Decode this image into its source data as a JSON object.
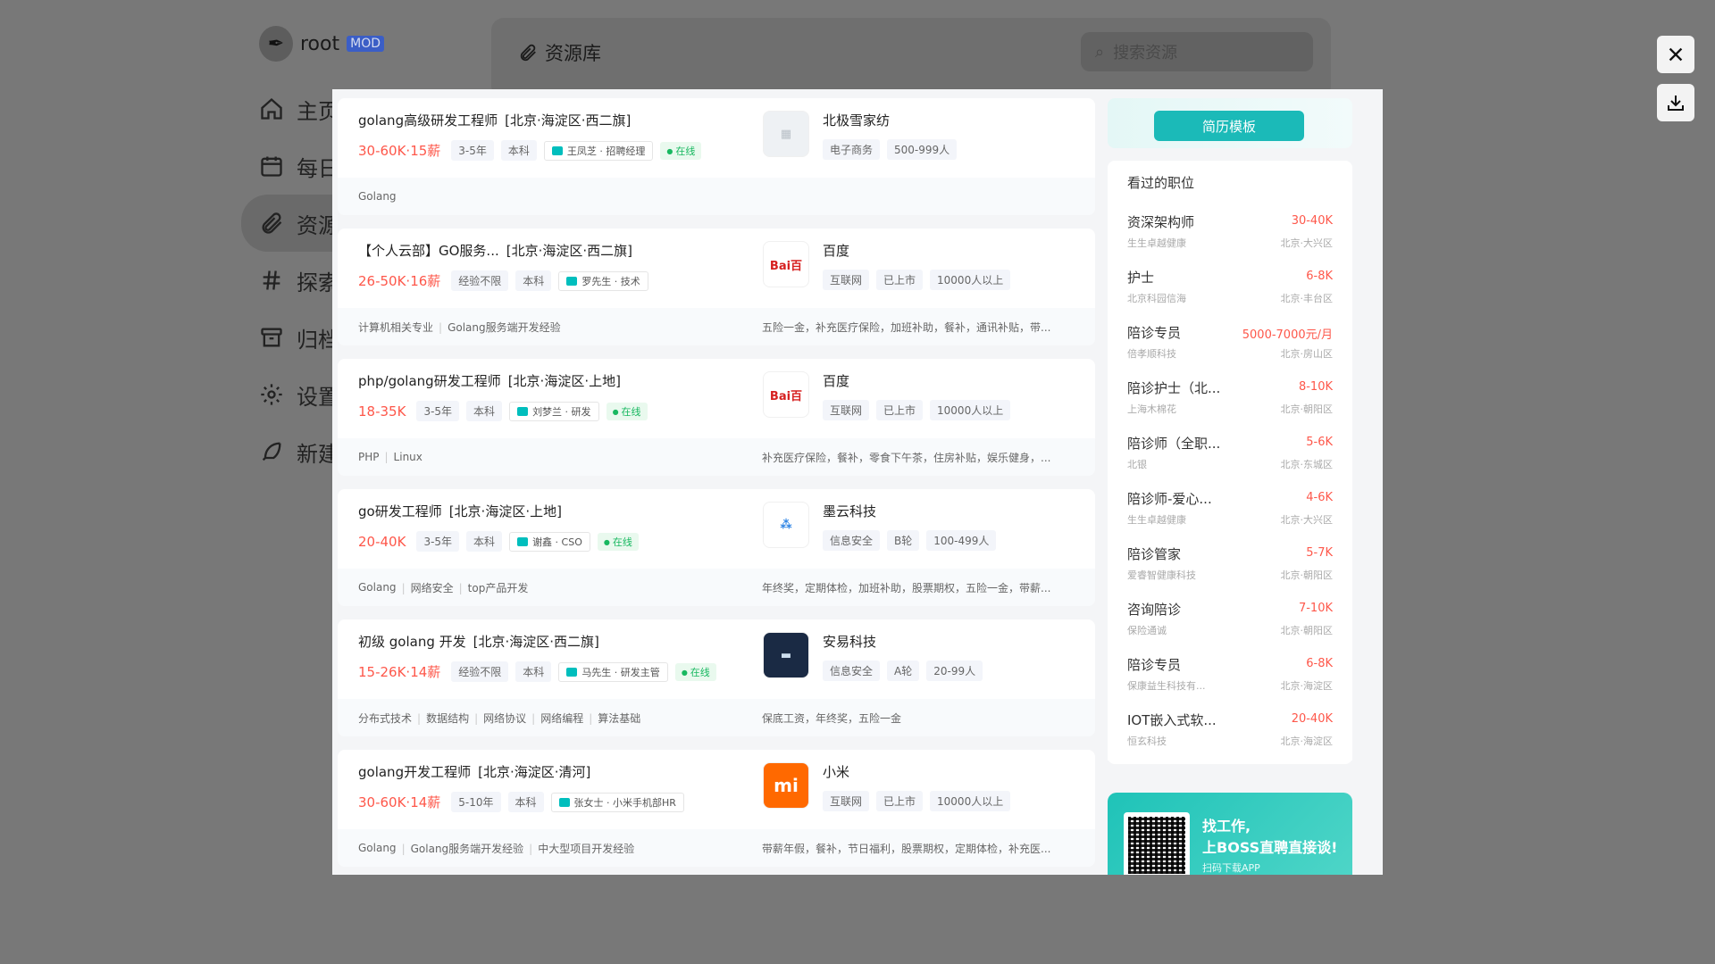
{
  "background": {
    "user": {
      "name": "root",
      "badge": "MOD"
    },
    "nav": [
      {
        "label": "主页",
        "icon": "home-icon"
      },
      {
        "label": "每日",
        "icon": "calendar-icon"
      },
      {
        "label": "资源",
        "icon": "paperclip-icon",
        "active": true
      },
      {
        "label": "探索",
        "icon": "hash-icon"
      },
      {
        "label": "归档",
        "icon": "archive-icon"
      },
      {
        "label": "设置",
        "icon": "settings-icon"
      },
      {
        "label": "新建",
        "icon": "feather-icon"
      }
    ],
    "main": {
      "title": "资源库",
      "search_placeholder": "搜索资源"
    }
  },
  "viewer_controls": {
    "close_icon": "close-icon",
    "download_icon": "download-icon"
  },
  "jobs": [
    {
      "title": "golang高级研发工程师",
      "area": "[北京·海淀区·西二旗]",
      "salary": "30-60K·15薪",
      "experience": "3-5年",
      "degree": "本科",
      "recruiter": "王凤芝 · 招聘经理",
      "online": "在线",
      "skills": [
        "Golang"
      ],
      "welfare": "",
      "company": "北极雪家纺",
      "company_tags": [
        "电子商务",
        "500-999人"
      ]
    },
    {
      "title": "【个人云部】GO服务...",
      "area": "[北京·海淀区·西二旗]",
      "salary": "26-50K·16薪",
      "experience": "经验不限",
      "degree": "本科",
      "recruiter": "罗先生 · 技术",
      "online": "",
      "skills": [
        "计算机相关专业",
        "Golang服务端开发经验"
      ],
      "welfare": "五险一金，补充医疗保险，加班补助，餐补，通讯补贴，带...",
      "company": "百度",
      "company_tags": [
        "互联网",
        "已上市",
        "10000人以上"
      ]
    },
    {
      "title": "php/golang研发工程师",
      "area": "[北京·海淀区·上地]",
      "salary": "18-35K",
      "experience": "3-5年",
      "degree": "本科",
      "recruiter": "刘梦兰 · 研发",
      "online": "在线",
      "skills": [
        "PHP",
        "Linux"
      ],
      "welfare": "补充医疗保险，餐补，零食下午茶，住房补贴，娱乐健身，...",
      "company": "百度",
      "company_tags": [
        "互联网",
        "已上市",
        "10000人以上"
      ]
    },
    {
      "title": "go研发工程师",
      "area": "[北京·海淀区·上地]",
      "salary": "20-40K",
      "experience": "3-5年",
      "degree": "本科",
      "recruiter": "谢鑫 · CSO",
      "online": "在线",
      "skills": [
        "Golang",
        "网络安全",
        "top产品开发"
      ],
      "welfare": "年终奖，定期体检，加班补助，股票期权，五险一金，带薪...",
      "company": "墨云科技",
      "company_tags": [
        "信息安全",
        "B轮",
        "100-499人"
      ]
    },
    {
      "title": "初级 golang 开发",
      "area": "[北京·海淀区·西二旗]",
      "salary": "15-26K·14薪",
      "experience": "经验不限",
      "degree": "本科",
      "recruiter": "马先生 · 研发主管",
      "online": "在线",
      "skills": [
        "分布式技术",
        "数据结构",
        "网络协议",
        "网络编程",
        "算法基础"
      ],
      "welfare": "保底工资，年终奖，五险一金",
      "company": "安易科技",
      "company_tags": [
        "信息安全",
        "A轮",
        "20-99人"
      ]
    },
    {
      "title": "golang开发工程师",
      "area": "[北京·海淀区·清河]",
      "salary": "30-60K·14薪",
      "experience": "5-10年",
      "degree": "本科",
      "recruiter": "张女士 · 小米手机部HR",
      "online": "",
      "skills": [
        "Golang",
        "Golang服务端开发经验",
        "中大型项目开发经验"
      ],
      "welfare": "带薪年假，餐补，节日福利，股票期权，定期体检，补充医...",
      "company": "小米",
      "company_tags": [
        "互联网",
        "已上市",
        "10000人以上"
      ]
    }
  ],
  "sidebar": {
    "resume_button": "简历模板",
    "viewed_title": "看过的职位",
    "viewed": [
      {
        "title": "资深架构师",
        "company": "生生卓越健康",
        "salary": "30-40K",
        "area": "北京·大兴区"
      },
      {
        "title": "护士",
        "company": "北京科园信海",
        "salary": "6-8K",
        "area": "北京·丰台区"
      },
      {
        "title": "陪诊专员",
        "company": "倍孝顺科技",
        "salary": "5000-7000元/月",
        "area": "北京·房山区"
      },
      {
        "title": "陪诊护士（北...",
        "company": "上海木棉花",
        "salary": "8-10K",
        "area": "北京·朝阳区"
      },
      {
        "title": "陪诊师（全职...",
        "company": "北银",
        "salary": "5-6K",
        "area": "北京·东城区"
      },
      {
        "title": "陪诊师-爱心...",
        "company": "生生卓越健康",
        "salary": "4-6K",
        "area": "北京·大兴区"
      },
      {
        "title": "陪诊管家",
        "company": "爱睿智健康科技",
        "salary": "5-7K",
        "area": "北京·朝阳区"
      },
      {
        "title": "咨询陪诊",
        "company": "保险通诚",
        "salary": "7-10K",
        "area": "北京·朝阳区"
      },
      {
        "title": "陪诊专员",
        "company": "保康益生科技有...",
        "salary": "6-8K",
        "area": "北京·海淀区"
      },
      {
        "title": "IOT嵌入式软...",
        "company": "恒玄科技",
        "salary": "20-40K",
        "area": "北京·海淀区"
      }
    ],
    "app_banner": {
      "line1": "找工作,",
      "line2": "上BOSS直聘直接谈!",
      "line3": "扫码下载APP"
    }
  },
  "colors": {
    "salary": "#fe574a",
    "accent": "#1bbab8",
    "online": "#18b860"
  }
}
